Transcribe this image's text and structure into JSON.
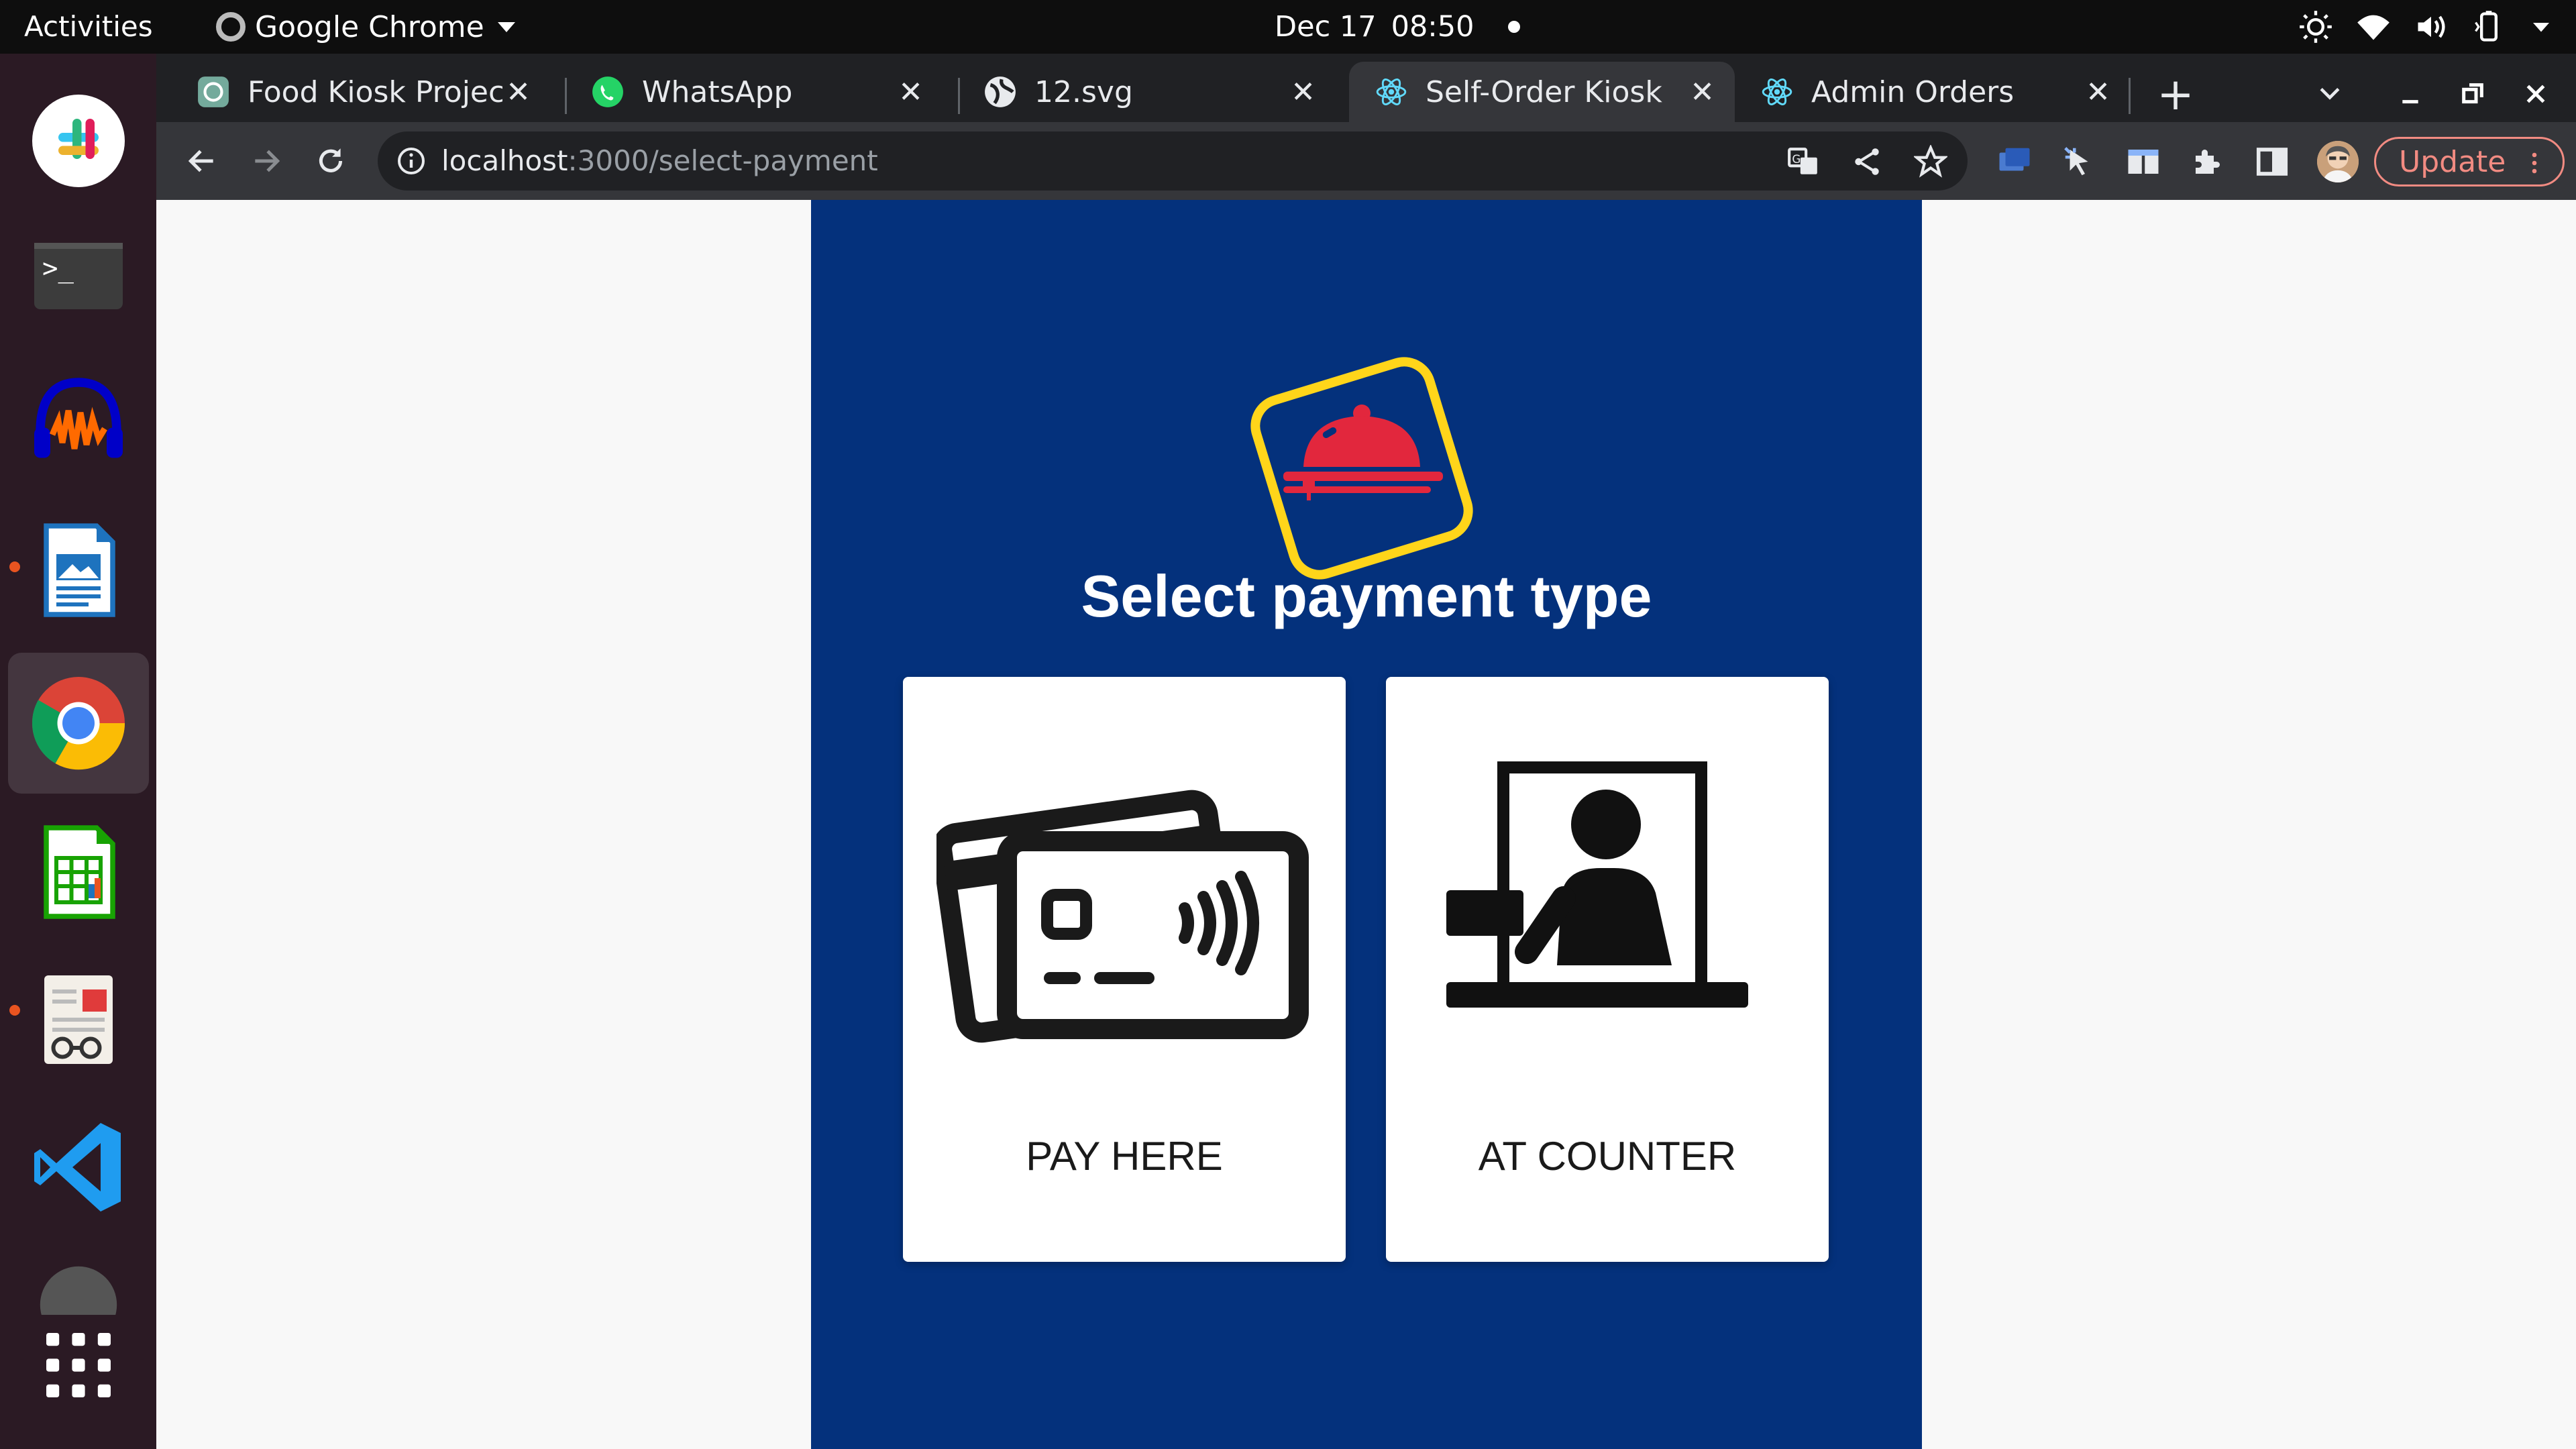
{
  "topbar": {
    "activities": "Activities",
    "app_name": "Google Chrome",
    "date": "Dec 17",
    "time": "08:50"
  },
  "dock": {
    "items": [
      {
        "icon": "slack-icon",
        "running": false
      },
      {
        "icon": "terminal-icon",
        "running": false
      },
      {
        "icon": "audacity-icon",
        "running": false
      },
      {
        "icon": "libreoffice-writer-icon",
        "running": true
      },
      {
        "icon": "chrome-icon",
        "running": true,
        "active": true
      },
      {
        "icon": "libreoffice-calc-icon",
        "running": false
      },
      {
        "icon": "document-viewer-icon",
        "running": false
      },
      {
        "icon": "vscode-icon",
        "running": true
      },
      {
        "icon": "show-apps-icon",
        "running": false
      }
    ]
  },
  "tabs": [
    {
      "title": "Food Kiosk Project",
      "favicon": "chatgpt-icon",
      "active": false
    },
    {
      "title": "WhatsApp",
      "favicon": "whatsapp-icon",
      "active": false
    },
    {
      "title": "12.svg",
      "favicon": "globe-icon",
      "active": false
    },
    {
      "title": "Self-Order Kiosk",
      "favicon": "react-icon",
      "active": true
    },
    {
      "title": "Admin Orders",
      "favicon": "react-icon",
      "active": false
    }
  ],
  "toolbar": {
    "url_host": "localhost",
    "url_path": ":3000/select-payment",
    "update_label": "Update"
  },
  "page": {
    "title": "Select payment type",
    "options": [
      {
        "label": "PAY HERE",
        "icon": "credit-card-contactless-icon"
      },
      {
        "label": "AT COUNTER",
        "icon": "cashier-counter-icon"
      }
    ]
  },
  "colors": {
    "kiosk_background": "#04317c",
    "logo_border": "#ffd51a",
    "logo_cloche": "#e2273d",
    "update_accent": "#f28b82",
    "ubuntu_orange": "#e95420"
  }
}
